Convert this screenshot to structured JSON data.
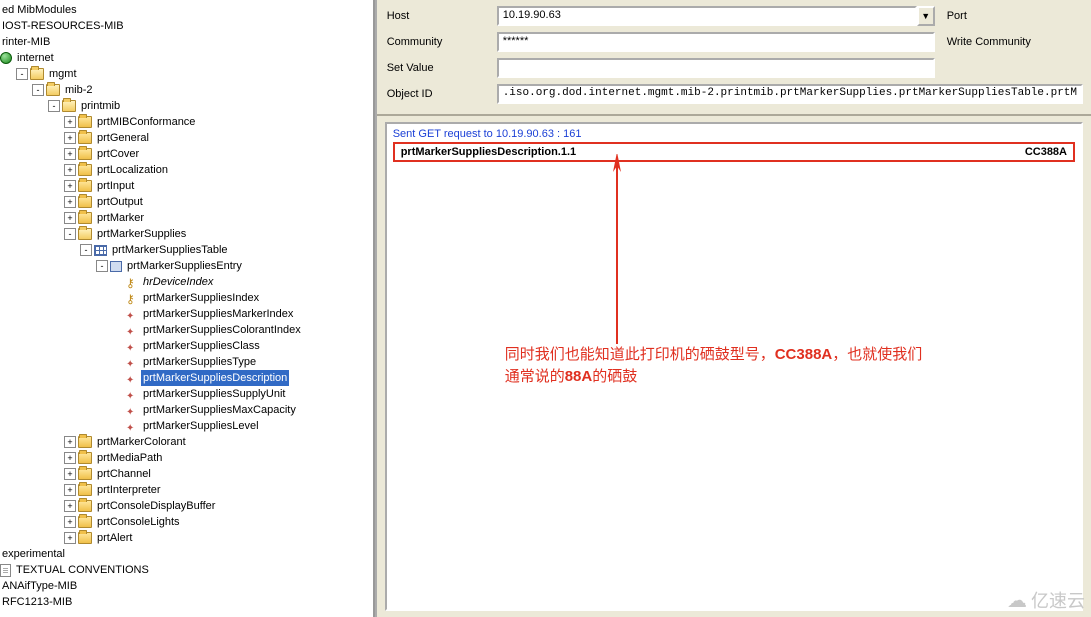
{
  "tree": {
    "root": "ed MibModules",
    "l1a": "IOST-RESOURCES-MIB",
    "l1b": "rinter-MIB",
    "internet": "internet",
    "mgmt": "mgmt",
    "mib2": "mib-2",
    "printmib": "printmib",
    "children": {
      "conf": "prtMIBConformance",
      "gen": "prtGeneral",
      "cover": "prtCover",
      "loc": "prtLocalization",
      "input": "prtInput",
      "output": "prtOutput",
      "marker": "prtMarker",
      "supplies": "prtMarkerSupplies",
      "suppliesTable": "prtMarkerSuppliesTable",
      "suppliesEntry": "prtMarkerSuppliesEntry",
      "e": {
        "hr": "hrDeviceIndex",
        "idx": "prtMarkerSuppliesIndex",
        "midx": "prtMarkerSuppliesMarkerIndex",
        "cidx": "prtMarkerSuppliesColorantIndex",
        "cls": "prtMarkerSuppliesClass",
        "typ": "prtMarkerSuppliesType",
        "desc": "prtMarkerSuppliesDescription",
        "unit": "prtMarkerSuppliesSupplyUnit",
        "max": "prtMarkerSuppliesMaxCapacity",
        "lvl": "prtMarkerSuppliesLevel"
      },
      "colorant": "prtMarkerColorant",
      "media": "prtMediaPath",
      "channel": "prtChannel",
      "interp": "prtInterpreter",
      "cdb": "prtConsoleDisplayBuffer",
      "clights": "prtConsoleLights",
      "alert": "prtAlert"
    },
    "exp": "experimental",
    "tc": "TEXTUAL CONVENTIONS",
    "iana": "ANAifType-MIB",
    "rfc": "RFC1213-MIB"
  },
  "form": {
    "host_label": "Host",
    "host_value": "10.19.90.63",
    "port_label": "Port",
    "community_label": "Community",
    "community_value": "******",
    "wcomm_label": "Write Community",
    "setvalue_label": "Set Value",
    "setvalue_value": "",
    "oid_label": "Object ID",
    "oid_value": ".iso.org.dod.internet.mgmt.mib-2.printmib.prtMarkerSupplies.prtMarkerSuppliesTable.prtM"
  },
  "output": {
    "request_msg": "Sent GET request to 10.19.90.63 : 161",
    "row_name": "prtMarkerSuppliesDescription.1.1",
    "row_value": "CC388A"
  },
  "annotation": {
    "line1_a": "同时我们也能知道此打印机的硒鼓型号，",
    "line1_b": "CC388A",
    "line1_c": "，也就使我们",
    "line2_a": "通常说的",
    "line2_b": "88A",
    "line2_c": "的硒鼓"
  },
  "watermark": "亿速云"
}
